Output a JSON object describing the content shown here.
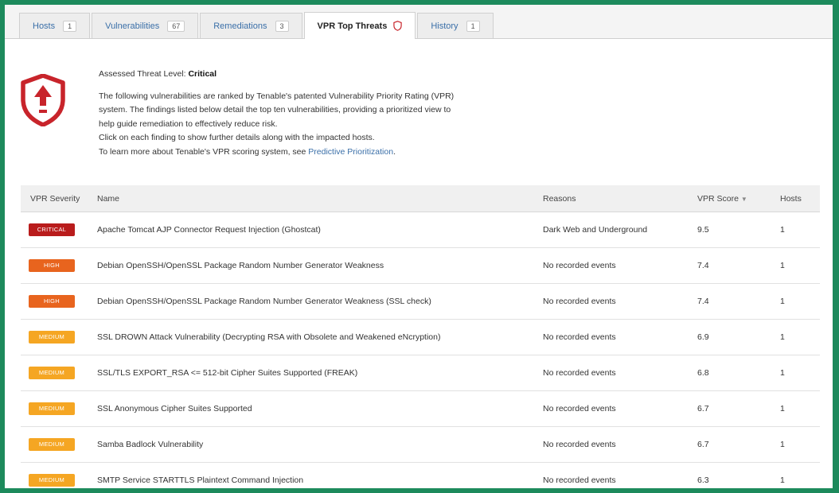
{
  "tabs": [
    {
      "label": "Hosts",
      "count": "1",
      "active": false
    },
    {
      "label": "Vulnerabilities",
      "count": "67",
      "active": false
    },
    {
      "label": "Remediations",
      "count": "3",
      "active": false
    },
    {
      "label": "VPR Top Threats",
      "count": null,
      "active": true,
      "icon": "shield-icon"
    },
    {
      "label": "History",
      "count": "1",
      "active": false
    }
  ],
  "summary": {
    "threat_label": "Assessed Threat Level:",
    "threat_value": "Critical",
    "lines": [
      "The following vulnerabilities are ranked by Tenable's patented Vulnerability Priority Rating (VPR)",
      "system. The findings listed below detail the top ten vulnerabilities, providing a prioritized view to",
      "help guide remediation to effectively reduce risk.",
      "Click on each finding to show further details along with the impacted hosts."
    ],
    "learn_more": "To learn more about Tenable's VPR scoring system, see",
    "link_text": "Predictive Prioritization",
    "icon": "shield-up-arrow-icon"
  },
  "table": {
    "headers": {
      "severity": "VPR Severity",
      "name": "Name",
      "reasons": "Reasons",
      "score": "VPR Score",
      "hosts": "Hosts"
    },
    "rows": [
      {
        "severity": "CRITICAL",
        "name": "Apache Tomcat AJP Connector Request Injection (Ghostcat)",
        "reasons": "Dark Web and Underground",
        "score": "9.5",
        "hosts": "1"
      },
      {
        "severity": "HIGH",
        "name": "Debian OpenSSH/OpenSSL Package Random Number Generator Weakness",
        "reasons": "No recorded events",
        "score": "7.4",
        "hosts": "1"
      },
      {
        "severity": "HIGH",
        "name": "Debian OpenSSH/OpenSSL Package Random Number Generator Weakness (SSL check)",
        "reasons": "No recorded events",
        "score": "7.4",
        "hosts": "1"
      },
      {
        "severity": "MEDIUM",
        "name": "SSL DROWN Attack Vulnerability (Decrypting RSA with Obsolete and Weakened eNcryption)",
        "reasons": "No recorded events",
        "score": "6.9",
        "hosts": "1"
      },
      {
        "severity": "MEDIUM",
        "name": "SSL/TLS EXPORT_RSA <= 512-bit Cipher Suites Supported (FREAK)",
        "reasons": "No recorded events",
        "score": "6.8",
        "hosts": "1"
      },
      {
        "severity": "MEDIUM",
        "name": "SSL Anonymous Cipher Suites Supported",
        "reasons": "No recorded events",
        "score": "6.7",
        "hosts": "1"
      },
      {
        "severity": "MEDIUM",
        "name": "Samba Badlock Vulnerability",
        "reasons": "No recorded events",
        "score": "6.7",
        "hosts": "1"
      },
      {
        "severity": "MEDIUM",
        "name": "SMTP Service STARTTLS Plaintext Command Injection",
        "reasons": "No recorded events",
        "score": "6.3",
        "hosts": "1"
      }
    ]
  },
  "colors": {
    "critical": "#b91c1c",
    "high": "#e8641e",
    "medium": "#f5a623",
    "accent": "#3a6fa8",
    "frame": "#1d8a5c",
    "shield": "#c8242b"
  }
}
